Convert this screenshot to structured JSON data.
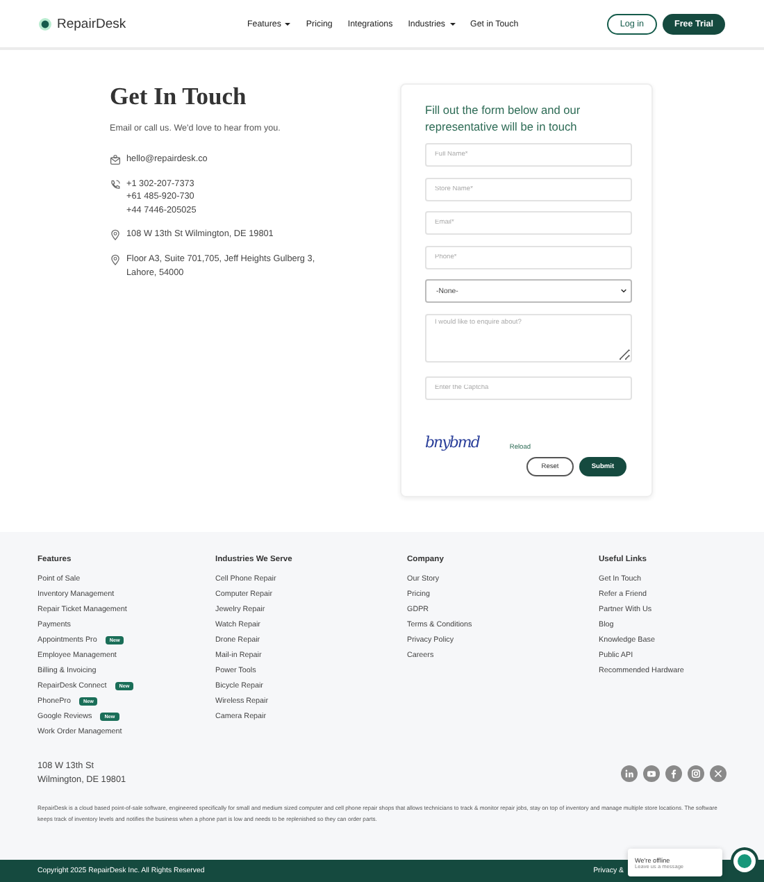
{
  "nav": {
    "brand": "RepairDesk",
    "links": [
      {
        "label": "Features",
        "dropdown": true
      },
      {
        "label": "Pricing",
        "dropdown": false
      },
      {
        "label": "Integrations",
        "dropdown": false
      },
      {
        "label": "Industries",
        "dropdown": true
      },
      {
        "label": "Get in Touch",
        "dropdown": false
      }
    ],
    "login": "Log in",
    "trial": "Free Trial"
  },
  "contact": {
    "title": "Get In Touch",
    "subtitle": "Email or call us. We'd love to hear from you.",
    "items": [
      {
        "kind": "email",
        "lines": [
          "hello@repairdesk.co"
        ]
      },
      {
        "kind": "phone",
        "lines": [
          "+1 302-207-7373",
          "+61 485-920-730",
          "+44 7446-205025"
        ]
      },
      {
        "kind": "location",
        "lines": [
          "108 W 13th St Wilmington, DE 19801"
        ]
      },
      {
        "kind": "location",
        "lines": [
          "Floor A3, Suite 701,705, Jeff Heights Gulberg 3,",
          "Lahore, 54000"
        ]
      }
    ]
  },
  "form": {
    "heading": "Fill out the form below and our representative will be in touch",
    "fields": [
      {
        "kind": "input",
        "placeholder": "Full Name*"
      },
      {
        "kind": "input",
        "placeholder": "Store Name*"
      },
      {
        "kind": "input",
        "placeholder": "Email*"
      },
      {
        "kind": "input",
        "placeholder": "Phone*"
      },
      {
        "kind": "select",
        "value": "-None-"
      },
      {
        "kind": "textarea",
        "placeholder": "I would like to enquire about?"
      },
      {
        "kind": "input",
        "placeholder": "Enter the Captcha"
      }
    ],
    "captcha": "bnybmd",
    "reload": "Reload",
    "reset": "Reset",
    "submit": "Submit"
  },
  "footer": {
    "columns": [
      {
        "title": "Features",
        "items": [
          {
            "label": "Point of Sale"
          },
          {
            "label": "Inventory Management"
          },
          {
            "label": "Repair Ticket Management"
          },
          {
            "label": "Payments"
          },
          {
            "label": "Appointments Pro",
            "badge": "New"
          },
          {
            "label": "Employee Management"
          },
          {
            "label": "Billing & Invoicing"
          },
          {
            "label": "RepairDesk Connect",
            "badge": "New"
          },
          {
            "label": "PhonePro",
            "badge": "New"
          },
          {
            "label": "Google Reviews",
            "badge": "New"
          },
          {
            "label": "Work Order Management"
          }
        ]
      },
      {
        "title": "Industries We Serve",
        "items": [
          {
            "label": "Cell Phone Repair"
          },
          {
            "label": "Computer Repair"
          },
          {
            "label": "Jewelry Repair"
          },
          {
            "label": "Watch Repair"
          },
          {
            "label": "Drone Repair"
          },
          {
            "label": "Mail-in Repair"
          },
          {
            "label": "Power Tools"
          },
          {
            "label": "Bicycle Repair"
          },
          {
            "label": "Wireless Repair"
          },
          {
            "label": "Camera Repair"
          }
        ]
      },
      {
        "title": "Company",
        "items": [
          {
            "label": "Our Story"
          },
          {
            "label": "Pricing"
          },
          {
            "label": "GDPR"
          },
          {
            "label": "Terms & Conditions"
          },
          {
            "label": "Privacy Policy"
          },
          {
            "label": "Careers"
          }
        ]
      },
      {
        "title": "Useful Links",
        "items": [
          {
            "label": "Get In Touch"
          },
          {
            "label": "Refer a Friend"
          },
          {
            "label": "Partner With Us"
          },
          {
            "label": "Blog"
          },
          {
            "label": "Knowledge Base"
          },
          {
            "label": "Public API"
          },
          {
            "label": "Recommended Hardware"
          }
        ]
      }
    ],
    "address": [
      "108 W 13th St",
      "Wilmington, DE 19801"
    ],
    "social": [
      {
        "kind": "linkedin"
      },
      {
        "kind": "youtube"
      },
      {
        "kind": "facebook"
      },
      {
        "kind": "instagram"
      },
      {
        "kind": "x"
      }
    ],
    "about": "RepairDesk is a cloud based point-of-sale software, engineered specifically for small and medium sized computer and cell phone repair shops that allows technicians to track & monitor repair jobs, stay on top of inventory and manage multiple store locations. The software keeps track of inventory levels and notifies the business when a phone part is low and needs to be replenished so they can order parts.",
    "copyright": "Copyright 2025 RepairDesk Inc. All Rights Reserved",
    "bottom_link": "Privacy &"
  },
  "chat": {
    "status": "We're offline",
    "prompt": "Leave us a message"
  }
}
